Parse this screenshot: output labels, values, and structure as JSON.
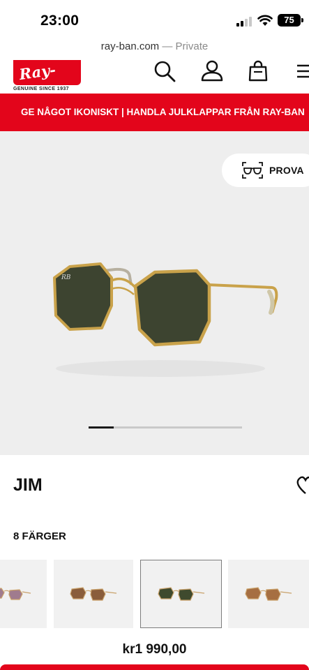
{
  "status_bar": {
    "time": "23:00",
    "battery": "75"
  },
  "browser": {
    "domain": "ray-ban.com",
    "separator": "—",
    "mode": "Private"
  },
  "header": {
    "logo_text": "Ray-Ban",
    "logo_tagline": "GENUINE SINCE 1937",
    "icons": [
      "search-icon",
      "account-icon",
      "bag-icon",
      "menu-icon"
    ]
  },
  "promo": {
    "text": "GE NÅGOT IKONISKT | HANDLA JULKLAPPAR FRÅN RAY-BAN"
  },
  "gallery": {
    "try_on_label": "PROVA",
    "slide_index": 1
  },
  "product": {
    "name": "JIM",
    "colors_label": "8 FÄRGER",
    "price": "kr1 990,00",
    "swatches": [
      {
        "frame": "#c9a16a",
        "lens": "#a07b8e",
        "selected": false
      },
      {
        "frame": "#c9a16a",
        "lens": "#8a5d3b",
        "selected": false
      },
      {
        "frame": "#c9a16a",
        "lens": "#3f4a2e",
        "selected": true
      },
      {
        "frame": "#c9a16a",
        "lens": "#a66f42",
        "selected": false
      }
    ]
  },
  "colors": {
    "brand_red": "#e3051b",
    "lens_green": "#3d4430",
    "frame_gold": "#c9a24a"
  }
}
